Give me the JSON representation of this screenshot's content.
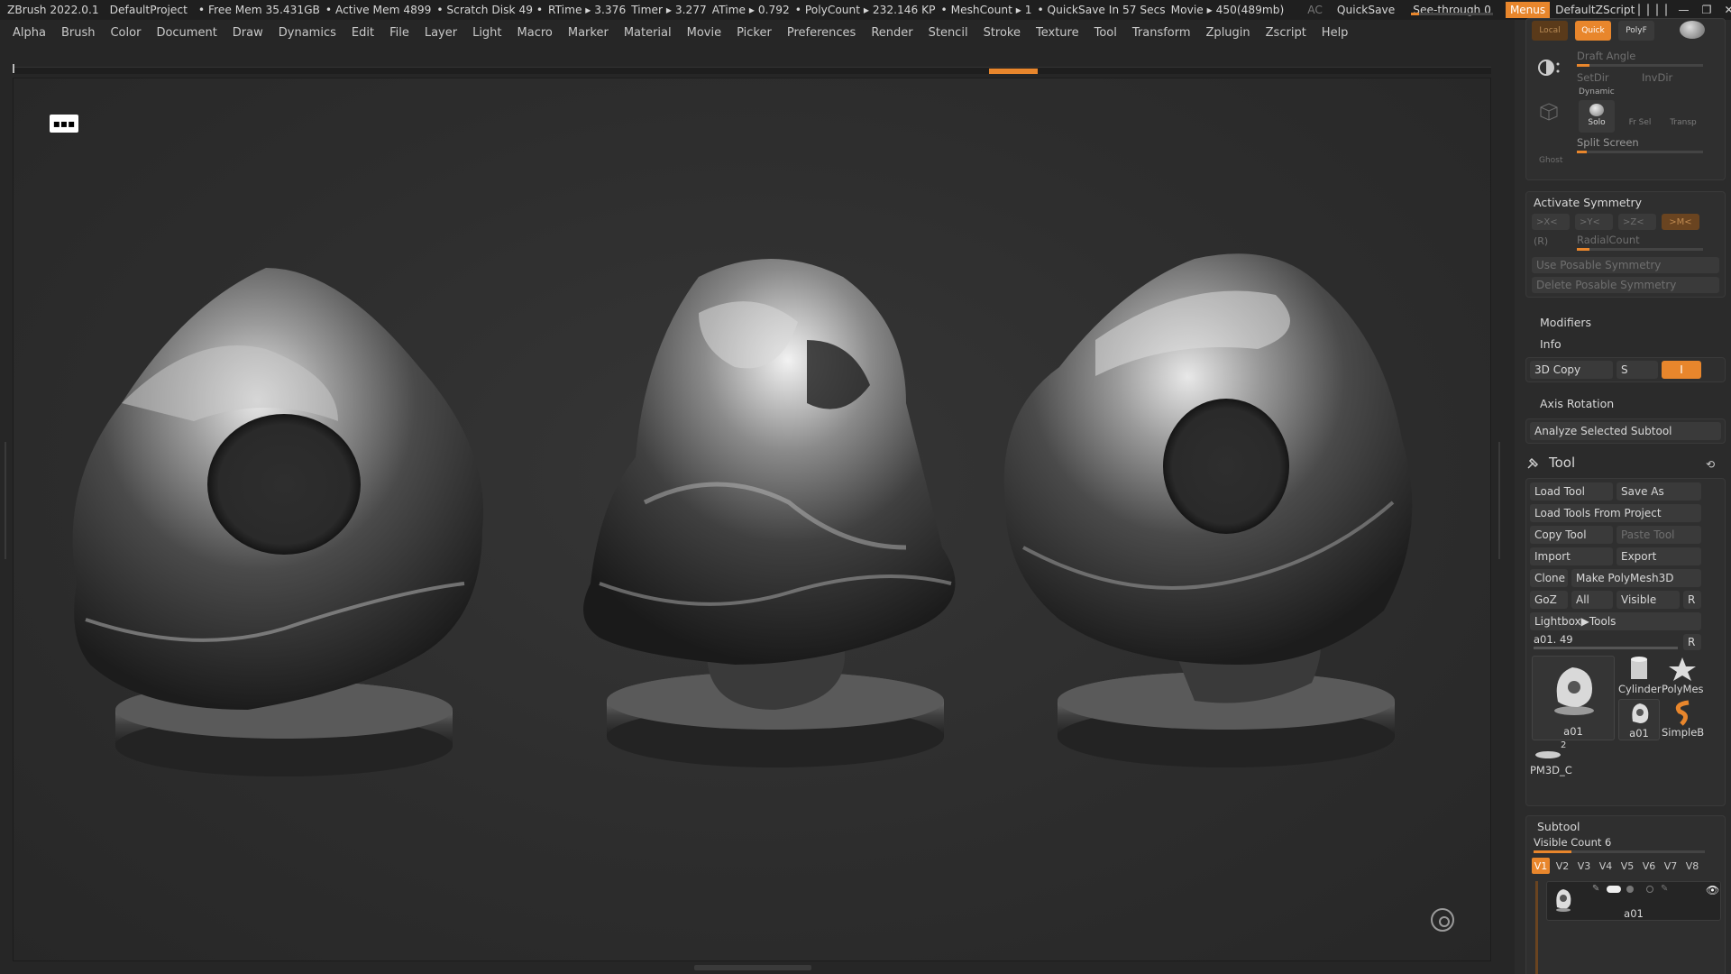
{
  "titlebar": {
    "app": "ZBrush 2022.0.1",
    "project": "DefaultProject",
    "free_mem": "• Free Mem 35.431GB",
    "active_mem": "• Active Mem 4899",
    "scratch": "• Scratch Disk 49 •",
    "rtime": "RTime ▸ 3.376",
    "timer": "Timer ▸ 3.277",
    "atime": "ATime ▸ 0.792",
    "polycount": "• PolyCount ▸ 232.146 KP",
    "meshcount": "• MeshCount ▸ 1",
    "quicksave_info": "• QuickSave In 57 Secs",
    "movie": "Movie ▸ 450(489mb)",
    "ac": "AC",
    "quicksave": "QuickSave",
    "see_through": "See-through",
    "see_through_value": "0",
    "menus": "Menus",
    "script": "DefaultZScript"
  },
  "menubar": {
    "items": [
      "Alpha",
      "Brush",
      "Color",
      "Document",
      "Draw",
      "Dynamics",
      "Edit",
      "File",
      "Layer",
      "Light",
      "Macro",
      "Marker",
      "Material",
      "Movie",
      "Picker",
      "Preferences",
      "Render",
      "Stencil",
      "Stroke",
      "Texture",
      "Tool",
      "Transform",
      "Zplugin",
      "Zscript",
      "Help"
    ]
  },
  "canvas": {
    "persp_icon": "▪▪▪"
  },
  "panel": {
    "top": {
      "local": "Local",
      "quick": "Quick",
      "polyf": "PolyF",
      "draft_angle": "Draft Angle",
      "setdir": "SetDir",
      "invdir": "InvDir",
      "dynamic": "Dynamic",
      "solo": "Solo",
      "frsel": "Fr Sel",
      "transp": "Transp",
      "split_screen": "Split Screen",
      "ghost": "Ghost"
    },
    "symmetry": {
      "activate": "Activate Symmetry",
      "x": ">X<",
      "y": ">Y<",
      "z": ">Z<",
      "m": ">M<",
      "r": "(R)",
      "radial_count": "RadialCount",
      "use_posable": "Use Posable Symmetry",
      "delete_posable": "Delete Posable Symmetry"
    },
    "modifiers": "Modifiers",
    "info": "Info",
    "copy3d": "3D Copy",
    "copy3d_s": "S",
    "copy3d_i": "I",
    "axis_rotation": "Axis Rotation",
    "analyze": "Analyze Selected Subtool",
    "tool": {
      "title": "Tool",
      "load_tool": "Load Tool",
      "save_as": "Save As",
      "load_from_project": "Load Tools From Project",
      "copy_tool": "Copy Tool",
      "paste_tool": "Paste Tool",
      "import": "Import",
      "export": "Export",
      "clone": "Clone",
      "make_polymesh": "Make PolyMesh3D",
      "goz": "GoZ",
      "all": "All",
      "visible": "Visible",
      "r": "R",
      "lightbox": "Lightbox▶Tools",
      "current": "a01. 49",
      "current_r": "R",
      "thumbs": {
        "main": "a01",
        "cylinder": "Cylinder",
        "polymesh": "PolyMes",
        "a01_small": "a01",
        "simpleb": "SimpleB",
        "pm3d": "PM3D_C",
        "pm3d_count": "2"
      }
    },
    "subtool": {
      "title": "Subtool",
      "visible_count": "Visible Count 6",
      "versions": [
        "V1",
        "V2",
        "V3",
        "V4",
        "V5",
        "V6",
        "V7",
        "V8"
      ],
      "item_name": "a01"
    }
  },
  "colors": {
    "accent": "#e8862c",
    "background": "#262626",
    "panel": "#2b2b2b"
  }
}
